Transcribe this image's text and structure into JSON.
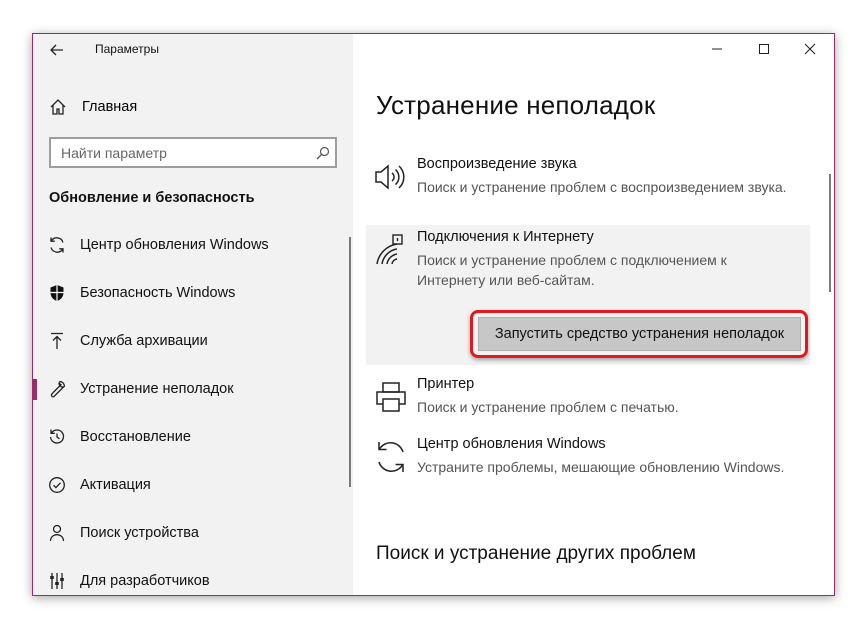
{
  "window": {
    "title": "Параметры",
    "accent_color": "#9a2a6a"
  },
  "sidebar": {
    "home_label": "Главная",
    "search_placeholder": "Найти параметр",
    "section_title": "Обновление и безопасность",
    "items": [
      {
        "label": "Центр обновления Windows",
        "icon": "sync-icon",
        "selected": false
      },
      {
        "label": "Безопасность Windows",
        "icon": "shield-icon",
        "selected": false
      },
      {
        "label": "Служба архивации",
        "icon": "backup-arrow-icon",
        "selected": false
      },
      {
        "label": "Устранение неполадок",
        "icon": "wrench-icon",
        "selected": true
      },
      {
        "label": "Восстановление",
        "icon": "recovery-icon",
        "selected": false
      },
      {
        "label": "Активация",
        "icon": "check-circle-icon",
        "selected": false
      },
      {
        "label": "Поиск устройства",
        "icon": "person-pin-icon",
        "selected": false
      },
      {
        "label": "Для разработчиков",
        "icon": "developer-sliders-icon",
        "selected": false
      }
    ]
  },
  "main": {
    "page_title": "Устранение неполадок",
    "troubleshooters": [
      {
        "name": "Воспроизведение звука",
        "description": "Поиск и устранение проблем с воспроизведением звука.",
        "icon": "speaker-icon"
      },
      {
        "name": "Подключения к Интернету",
        "description": "Поиск и устранение проблем с подключением к Интернету или веб-сайтам.",
        "icon": "network-icon",
        "selected": true
      },
      {
        "name": "Принтер",
        "description": "Поиск и устранение проблем с печатью.",
        "icon": "printer-icon"
      },
      {
        "name": "Центр обновления Windows",
        "description": "Устраните проблемы, мешающие обновлению Windows.",
        "icon": "sync-icon"
      }
    ],
    "run_button_label": "Запустить средство устранения неполадок",
    "highlight_color": "#e0191f",
    "other_section_title": "Поиск и устранение других проблем"
  }
}
